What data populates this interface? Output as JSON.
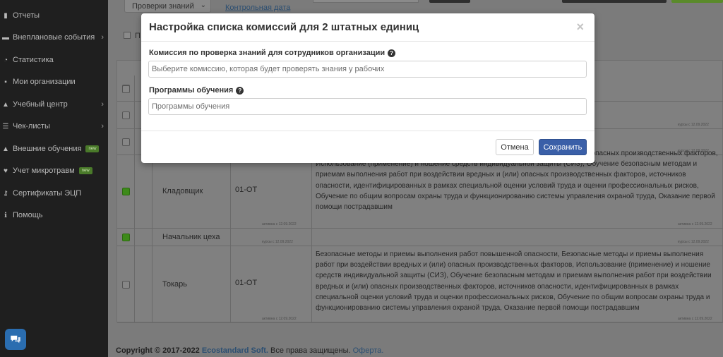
{
  "sidebar": {
    "items": [
      {
        "label": "Отчеты",
        "icon": "clipboard-icon",
        "chevron": false,
        "badge": ""
      },
      {
        "label": "Внеплановые события",
        "icon": "folder-icon",
        "chevron": true,
        "badge": ""
      },
      {
        "label": "Статистика",
        "icon": "pie-chart-icon",
        "chevron": false,
        "badge": ""
      },
      {
        "label": "Мои организации",
        "icon": "briefcase-icon",
        "chevron": false,
        "badge": ""
      },
      {
        "label": "Учебный центр",
        "icon": "graduation-cap-icon",
        "chevron": true,
        "badge": ""
      },
      {
        "label": "Чек-листы",
        "icon": "checklist-icon",
        "chevron": true,
        "badge": ""
      },
      {
        "label": "Внешние обучения",
        "icon": "graduation-cap-icon",
        "chevron": false,
        "badge": "new"
      },
      {
        "label": "Учет микротравм",
        "icon": "heart-icon",
        "chevron": false,
        "badge": "new"
      },
      {
        "label": "Сертификаты ЭЦП",
        "icon": "key-icon",
        "chevron": false,
        "badge": ""
      },
      {
        "label": "Помощь",
        "icon": "info-icon",
        "chevron": false,
        "badge": ""
      }
    ]
  },
  "top": {
    "select_value": "Проверки знаний",
    "link": "Контрольная дата",
    "checkbox_label": "П"
  },
  "table": {
    "rows": [
      {
        "name": "",
        "code": "",
        "programs": "",
        "checked": false,
        "tiny_left": "",
        "tiny_right": "",
        "partial": true
      },
      {
        "name": "",
        "code": "",
        "programs": "",
        "checked": false,
        "tiny_left": "",
        "tiny_right": "курсы с 12.09.2022"
      },
      {
        "name": "",
        "code": "",
        "programs": "",
        "checked": false,
        "tiny_left": "",
        "tiny_right": "курсы с 12.09.2022"
      },
      {
        "name": "Кладовщик",
        "code": "01-ОТ",
        "programs": "Безопасные методы и приемы выполнения работ при воздействии вредных и (или) опасных производственных факторов, Использование (применение) и ношение средств индивидуальной защиты (СИЗ), Обучение безопасным методам и приемам выполнения работ при воздействии вредных и (или) опасных производственных факторов, источников опасности, идентифицированных в рамках специальной оценки условий труда и оценки профессиональных рисков, Обучение по общим вопросам охраны труда и функционированию системы управления охраной труда, Оказание первой помощи пострадавшим",
        "checked": true,
        "tiny_left": "активна с 12.09.2022",
        "tiny_right": "активна с 12.09.2022"
      },
      {
        "name": "Начальник цеха",
        "code": "",
        "programs": "",
        "checked": true,
        "tiny_left": "курсы с 12.09.2022",
        "tiny_right": "курсы с 12.09.2022"
      },
      {
        "name": "Токарь",
        "code": "01-ОТ",
        "programs": "Безопасные методы и приемы выполнения работ повышенной опасности, Безопасные методы и приемы выполнения работ при воздействии вредных и (или) опасных производственных факторов, Использование (применение) и ношение средств индивидуальной защиты (СИЗ), Обучение безопасным методам и приемам выполнения работ при воздействии вредных и (или) опасных производственных факторов, источников опасности, идентифицированных в рамках специальной оценки условий труда и оценки профессиональных рисков, Обучение по общим вопросам охраны труда и функционированию системы управления охраной труда, Оказание первой помощи пострадавшим",
        "checked": false,
        "tiny_left": "активна с 12.09.2022",
        "tiny_right": "активна с 12.09.2022"
      }
    ]
  },
  "footer": {
    "copyright": "Copyright © 2017-2022",
    "brand": "Ecostandard Soft.",
    "rights": "Все права защищены.",
    "offer": "Оферта."
  },
  "modal": {
    "title": "Настройка списка комиссий для 2 штатных единиц",
    "close": "×",
    "commission_label": "Комиссия по проверка знаний для сотрудников организации",
    "commission_placeholder": "Выберите комиссию, которая будет проверять знания у рабочих",
    "programs_label": "Программы обучения",
    "programs_placeholder": "Программы обучения",
    "help": "?",
    "cancel": "Отмена",
    "save": "Сохранить"
  },
  "colors": {
    "primary": "#3a5fa8",
    "sidebar_bg": "#1f1f1f",
    "checked_green": "#3d8a1a"
  }
}
